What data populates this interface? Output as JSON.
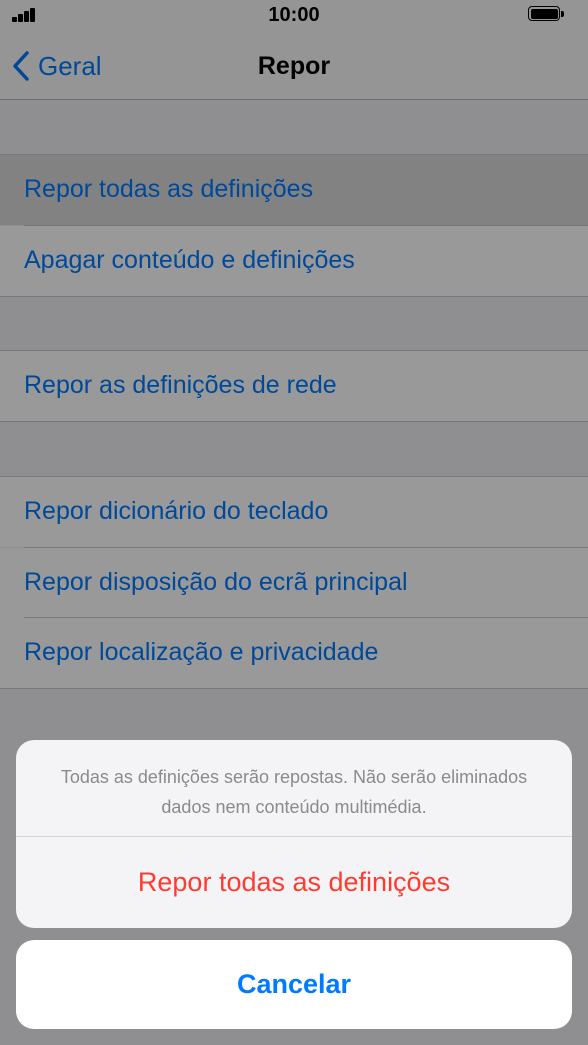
{
  "status_bar": {
    "time": "10:00",
    "signal_icon": "signal-bars-icon",
    "battery_icon": "battery-full-icon"
  },
  "nav": {
    "back_label": "Geral",
    "back_icon": "chevron-left-icon",
    "title": "Repor"
  },
  "settings": {
    "items": [
      {
        "label": "Repor todas as definições"
      },
      {
        "label": "Apagar conteúdo e definições"
      },
      {
        "label": "Repor as definições de rede"
      },
      {
        "label": "Repor dicionário do teclado"
      },
      {
        "label": "Repor disposição do ecrã principal"
      },
      {
        "label": "Repor localização e privacidade"
      }
    ]
  },
  "action_sheet": {
    "message": "Todas as definições serão repostas. Não serão eliminados dados nem conteúdo multimédia.",
    "destructive_label": "Repor todas as definições",
    "cancel_label": "Cancelar"
  },
  "colors": {
    "accent": "#007aff",
    "destructive": "#ff3b30",
    "overlay": "rgba(0,0,0,0.40)"
  }
}
